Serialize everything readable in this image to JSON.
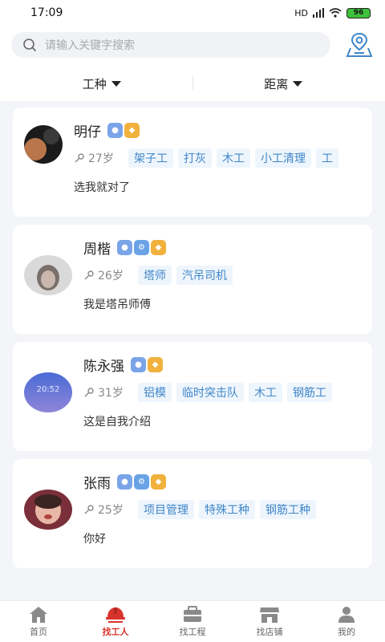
{
  "status_bar": {
    "time": "17:09",
    "battery": "96",
    "signal": "HD"
  },
  "search": {
    "placeholder": "请输入关键字搜索"
  },
  "filters": [
    {
      "label": "工种"
    },
    {
      "label": "距离"
    }
  ],
  "workers": [
    {
      "name": "明仔",
      "age": "27岁",
      "tags": [
        "架子工",
        "打灰",
        "木工",
        "小工清理",
        "工"
      ],
      "intro": "选我就对了",
      "badges": [
        "person",
        "gold"
      ]
    },
    {
      "name": "周楷",
      "age": "26岁",
      "tags": [
        "塔师",
        "汽吊司机"
      ],
      "intro": "我是塔吊师傅",
      "badges": [
        "person",
        "tool",
        "gold"
      ]
    },
    {
      "name": "陈永强",
      "age": "31岁",
      "tags": [
        "铝模",
        "临时突击队",
        "木工",
        "钢筋工"
      ],
      "intro": "这是自我介绍",
      "badges": [
        "person",
        "gold"
      ],
      "avatar_text": "20:52"
    },
    {
      "name": "张雨",
      "age": "25岁",
      "tags": [
        "项目管理",
        "特殊工种",
        "钢筋工种"
      ],
      "intro": "你好",
      "badges": [
        "person",
        "tool",
        "gold"
      ]
    }
  ],
  "tabs": [
    {
      "label": "首页",
      "icon": "home-icon",
      "active": false
    },
    {
      "label": "找工人",
      "icon": "worker-helmet-icon",
      "active": true
    },
    {
      "label": "找工程",
      "icon": "project-icon",
      "active": false
    },
    {
      "label": "找店铺",
      "icon": "shop-icon",
      "active": false
    },
    {
      "label": "我的",
      "icon": "user-icon",
      "active": false
    }
  ],
  "colors": {
    "accent": "#d8332c",
    "tag_text": "#3f86c9",
    "tag_bg": "#eef5fc"
  }
}
